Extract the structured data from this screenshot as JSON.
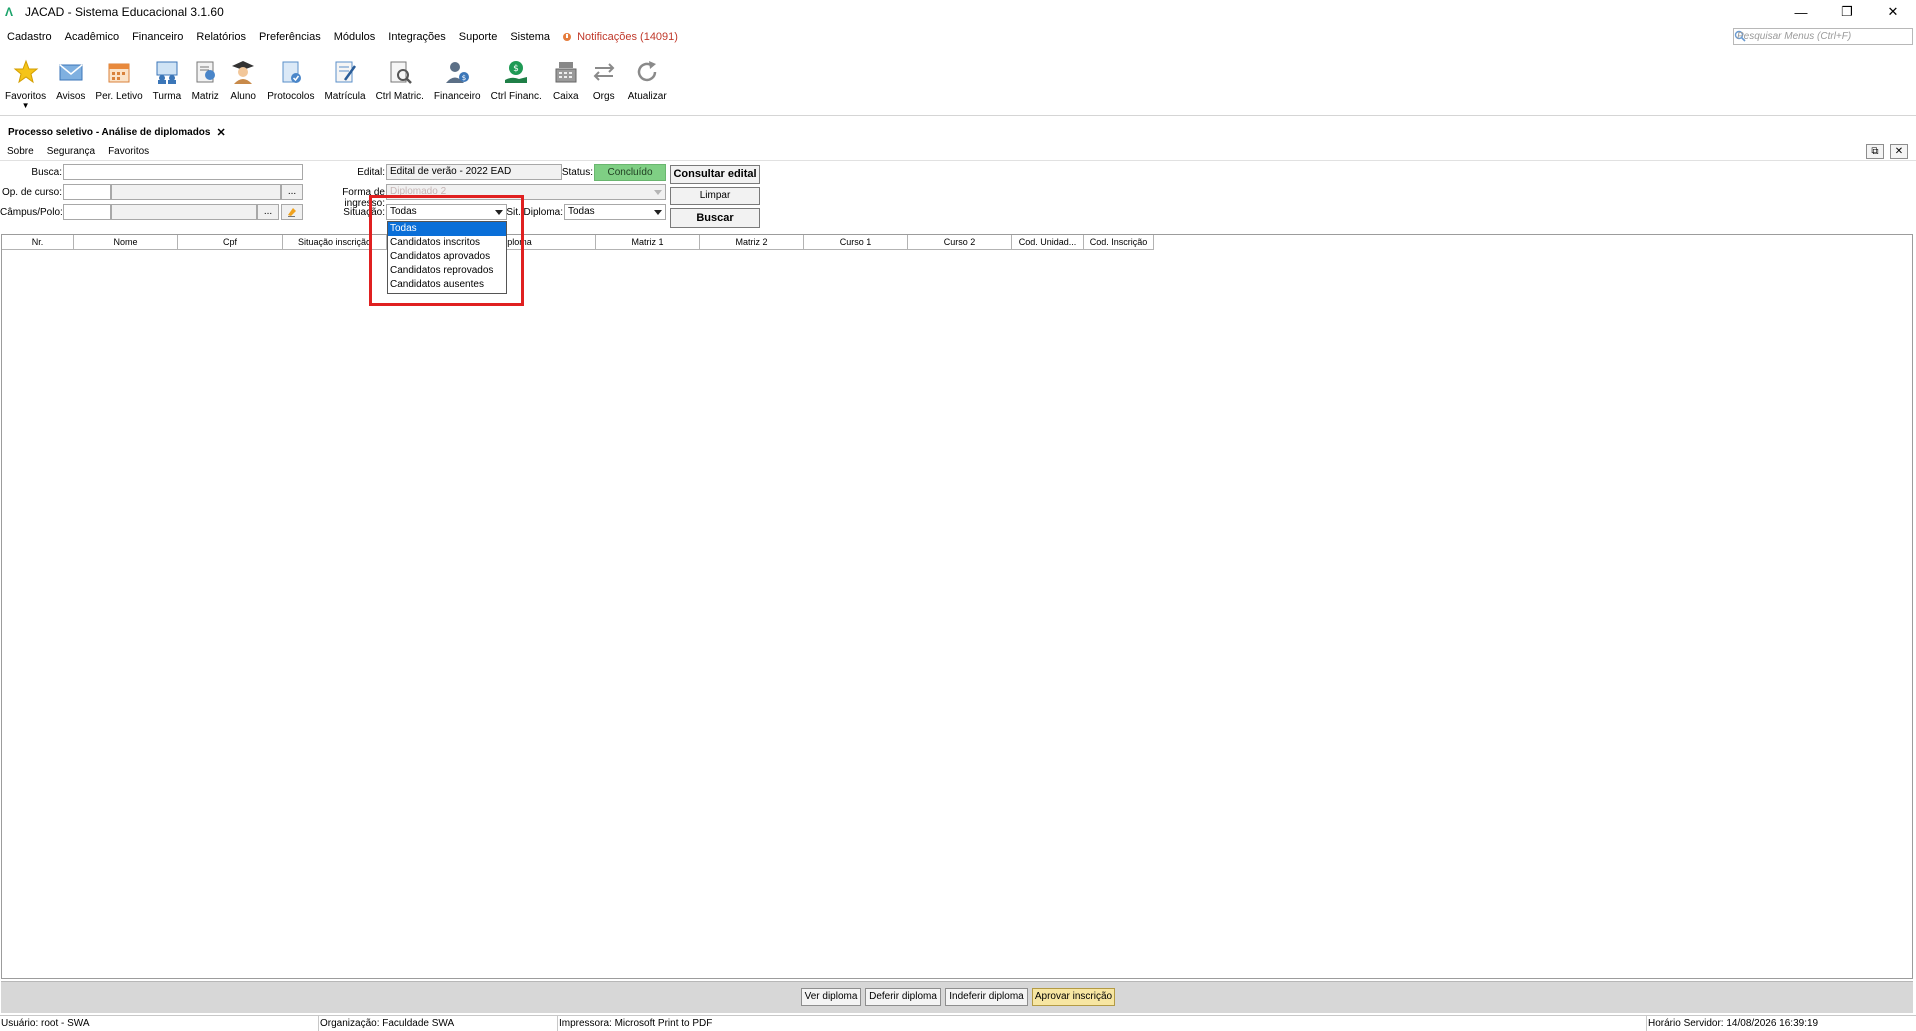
{
  "window": {
    "title": "JACAD - Sistema Educacional 3.1.60",
    "minimize": "—",
    "restore": "❐",
    "close": "✕"
  },
  "menu": {
    "items": [
      "Cadastro",
      "Acadêmico",
      "Financeiro",
      "Relatórios",
      "Preferências",
      "Módulos",
      "Integrações",
      "Suporte",
      "Sistema"
    ],
    "notifications": "Notificações (14091)",
    "search_placeholder": "Pesquisar Menus (Ctrl+F)"
  },
  "toolbar": {
    "buttons": [
      "Favoritos",
      "Avisos",
      "Per. Letivo",
      "Turma",
      "Matriz",
      "Aluno",
      "Protocolos",
      "Matrícula",
      "Ctrl Matric.",
      "Financeiro",
      "Ctrl Financ.",
      "Caixa",
      "Orgs",
      "Atualizar"
    ]
  },
  "tab": {
    "title": "Processo seletivo - Análise de diplomados",
    "close": "✕"
  },
  "submenu": {
    "items": [
      "Sobre",
      "Segurança",
      "Favoritos"
    ]
  },
  "form": {
    "busca_label": "Busca:",
    "busca_value": "",
    "op_curso_label": "Op. de curso:",
    "campus_label": "Câmpus/Polo:",
    "browse": "...",
    "edital_label": "Edital:",
    "edital_value": "Edital de verão - 2022 EAD",
    "status_label": "Status:",
    "status_value": "Concluído",
    "forma_ingresso_label": "Forma de ingresso:",
    "forma_ingresso_value": "Diplomado 2",
    "situacao_label": "Situação:",
    "situacao_value": "Todas",
    "sit_diploma_label": "Sit. Diploma:",
    "sit_diploma_value": "Todas",
    "consultar_edital": "Consultar edital",
    "limpar": "Limpar",
    "buscar": "Buscar"
  },
  "dropdown": {
    "options": [
      "Todas",
      "Candidatos inscritos",
      "Candidatos aprovados",
      "Candidatos reprovados",
      "Candidatos ausentes"
    ],
    "selected_index": 0
  },
  "table": {
    "columns": [
      "Nr.",
      "Nome",
      "Cpf",
      "Situação inscrição",
      "Situação do diploma",
      "Matriz 1",
      "Matriz 2",
      "Curso 1",
      "Curso 2",
      "Cod. Unidad...",
      "Cod. Inscrição"
    ]
  },
  "actions": {
    "ver_diploma": "Ver diploma",
    "deferir_diploma": "Deferir diploma",
    "indeferir_diploma": "Indeferir diploma",
    "aprovar_inscricao": "Aprovar inscrição"
  },
  "statusbar": {
    "usuario": "Usuário: root - SWA",
    "organizacao": "Organização: Faculdade SWA",
    "impressora": "Impressora: Microsoft Print to PDF",
    "horario": "Horário Servidor: 14/08/2026 16:39:19"
  },
  "colors": {
    "accent": "#0a6fd8",
    "status_green": "#7fcf84",
    "highlight_red": "#e02020",
    "notification_red": "#c0392b"
  }
}
